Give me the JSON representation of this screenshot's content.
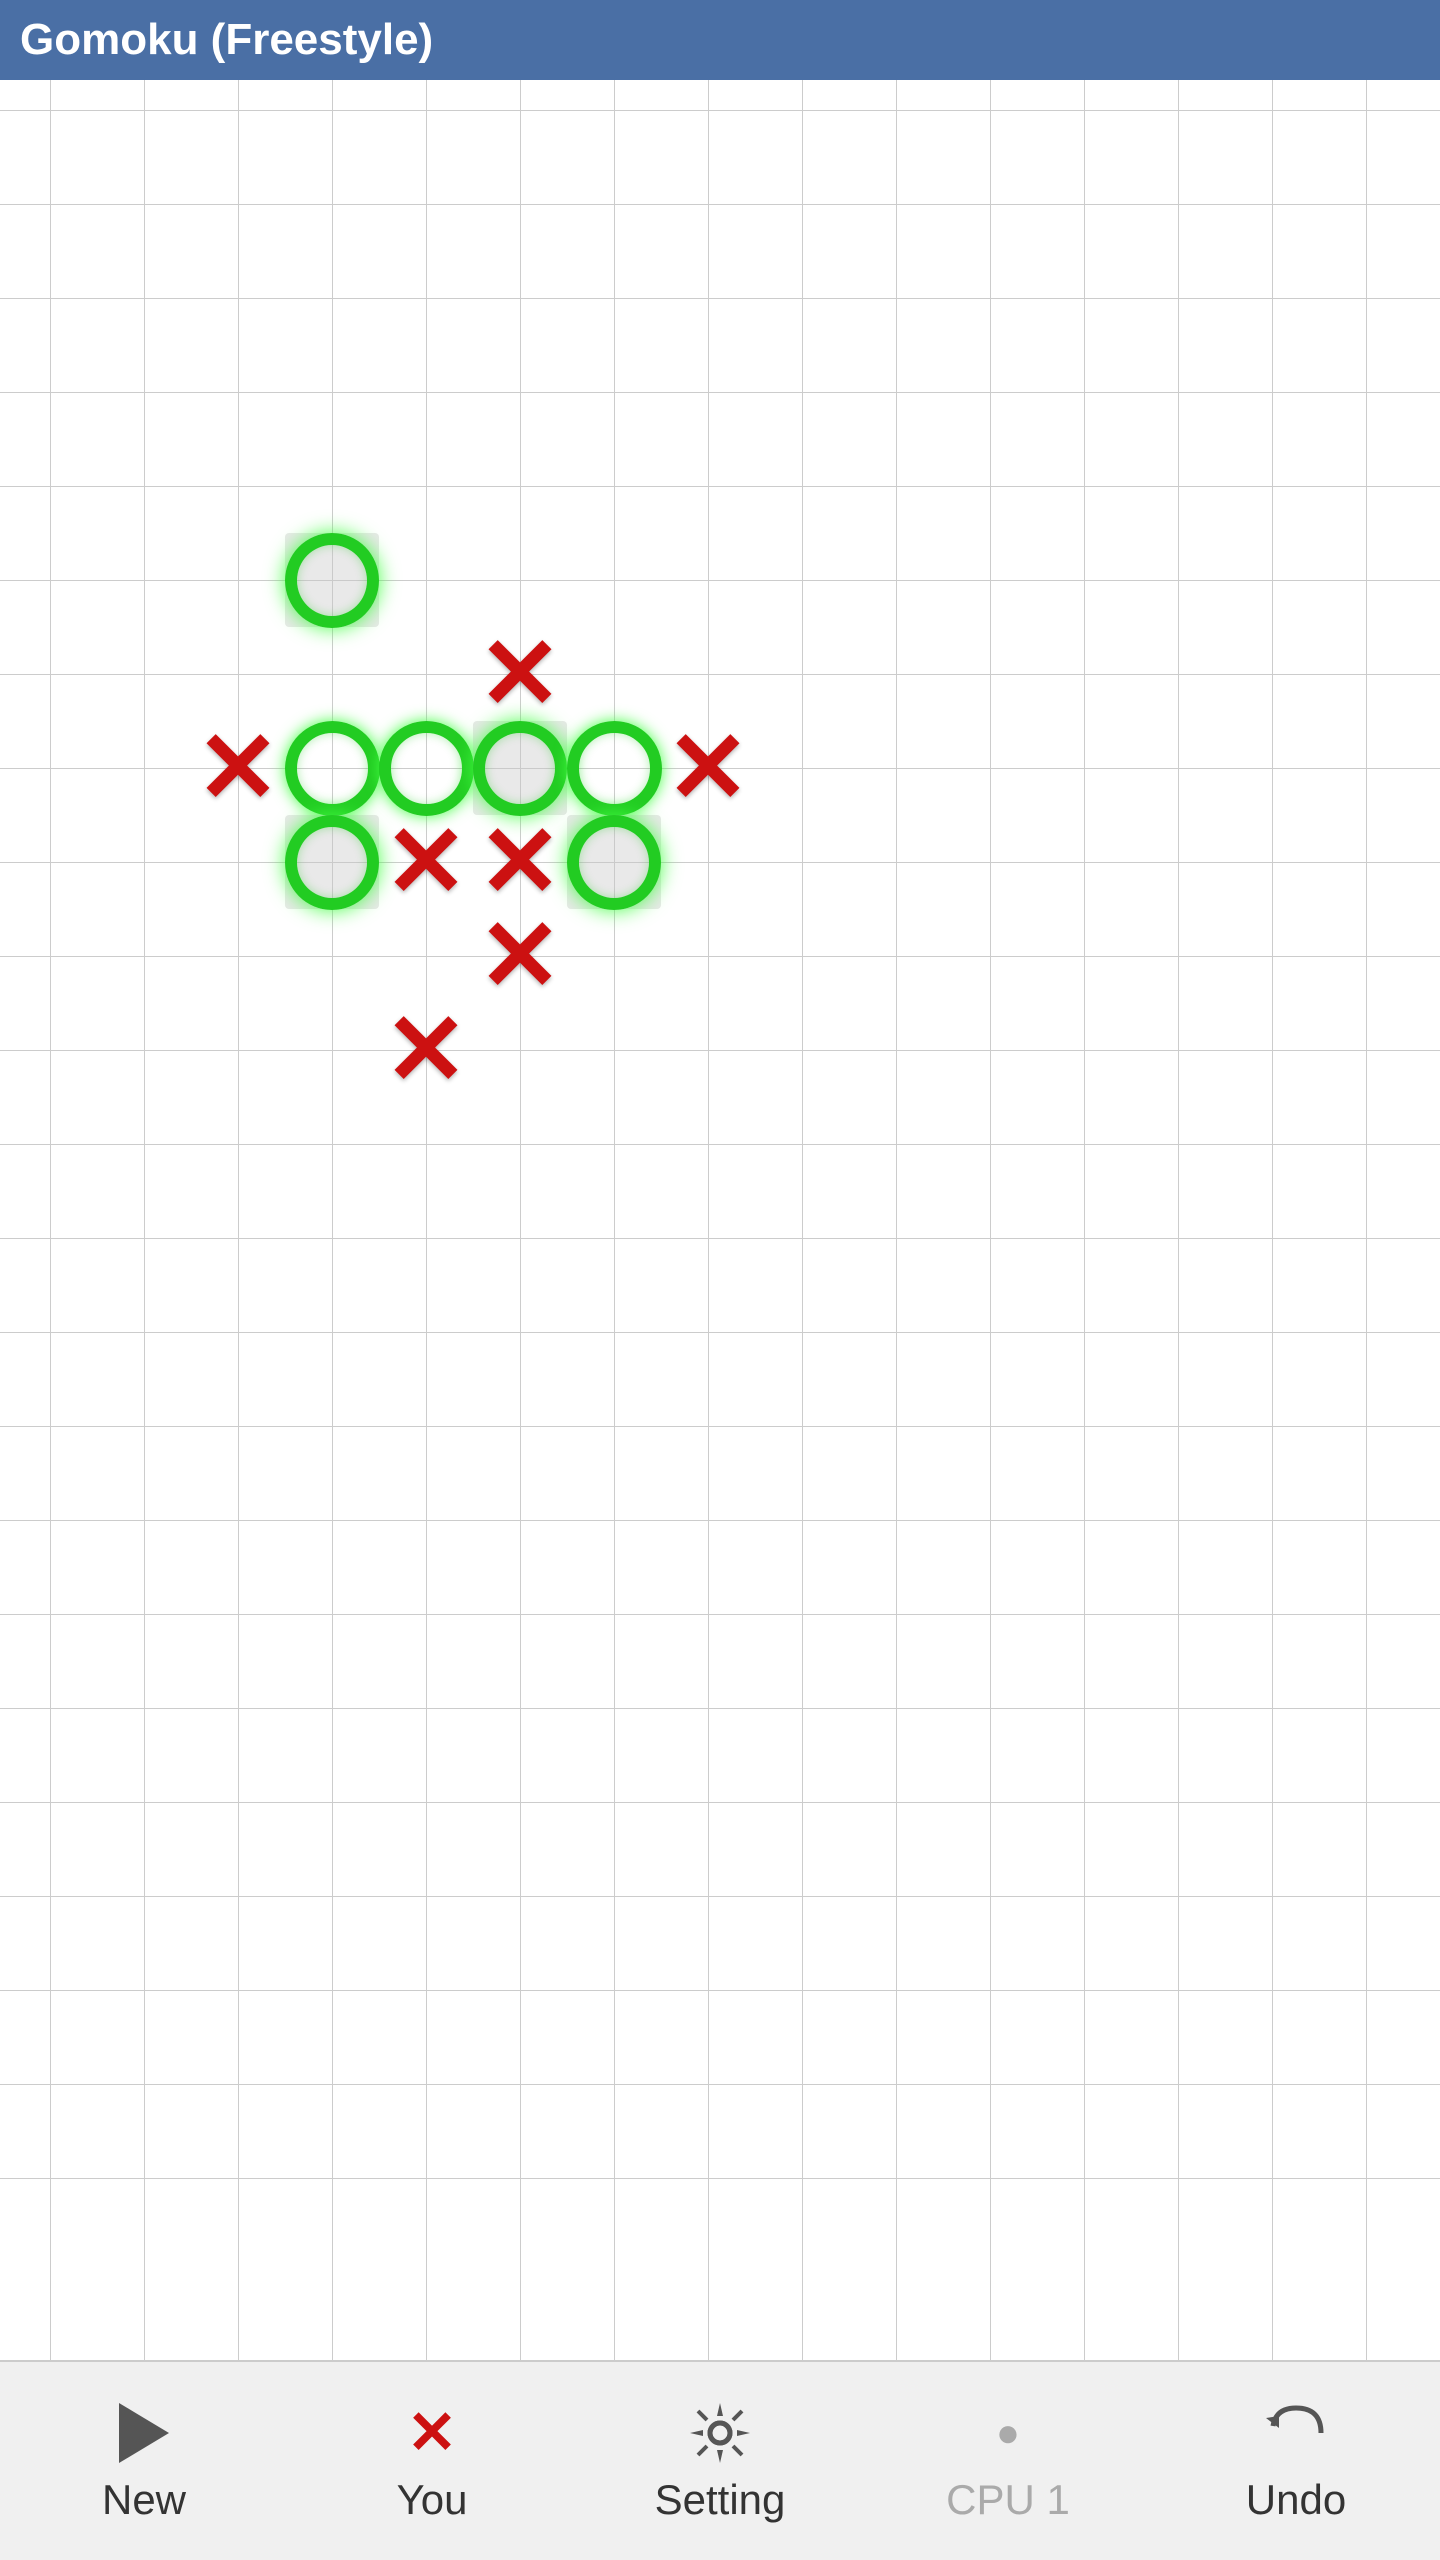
{
  "title": "Gomoku (Freestyle)",
  "board": {
    "cols": 15,
    "rows": 22,
    "cell_size": 94
  },
  "pieces": [
    {
      "type": "O",
      "col": 3,
      "row": 5,
      "highlighted": true
    },
    {
      "type": "X",
      "col": 5,
      "row": 6
    },
    {
      "type": "X",
      "col": 2,
      "row": 7
    },
    {
      "type": "O",
      "col": 3,
      "row": 7
    },
    {
      "type": "O",
      "col": 4,
      "row": 7
    },
    {
      "type": "O",
      "col": 5,
      "row": 7,
      "highlighted": true
    },
    {
      "type": "O",
      "col": 6,
      "row": 7
    },
    {
      "type": "X",
      "col": 7,
      "row": 7
    },
    {
      "type": "O",
      "col": 3,
      "row": 8,
      "highlighted": true
    },
    {
      "type": "X",
      "col": 4,
      "row": 8
    },
    {
      "type": "X",
      "col": 5,
      "row": 8
    },
    {
      "type": "O",
      "col": 6,
      "row": 8,
      "highlighted": true
    },
    {
      "type": "X",
      "col": 5,
      "row": 9
    },
    {
      "type": "X",
      "col": 4,
      "row": 10
    }
  ],
  "bottom_bar": {
    "new_label": "New",
    "you_label": "You",
    "setting_label": "Setting",
    "cpu_label": "CPU 1",
    "undo_label": "Undo"
  }
}
